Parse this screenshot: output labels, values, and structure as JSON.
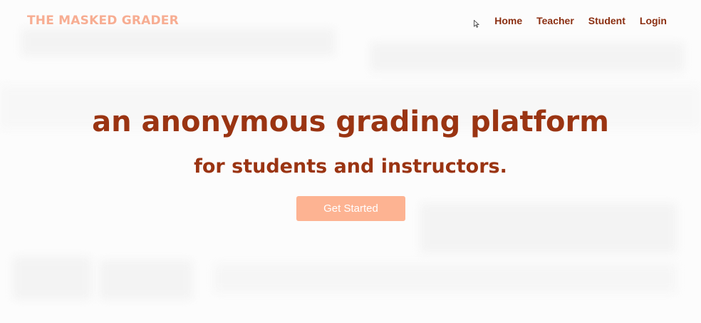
{
  "brand": {
    "name": "THE MASKED GRADER"
  },
  "nav": {
    "items": [
      {
        "label": "Home"
      },
      {
        "label": "Teacher"
      },
      {
        "label": "Student"
      },
      {
        "label": "Login"
      }
    ]
  },
  "hero": {
    "title": "an anonymous grading platform",
    "subtitle": "for students and instructors.",
    "cta_label": "Get Started"
  },
  "colors": {
    "logo": "#f7ad92",
    "nav_text": "#8b2f12",
    "heading": "#9a3412",
    "button": "#fdb392",
    "button_text": "#ffffff"
  },
  "icons": {
    "cursor": "mouse-pointer-icon"
  }
}
